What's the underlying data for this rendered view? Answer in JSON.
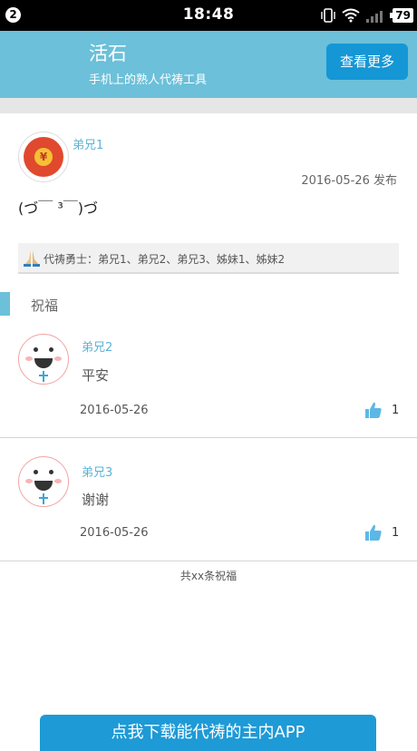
{
  "status_bar": {
    "notification_count": "2",
    "time": "18:48",
    "battery": "79"
  },
  "header": {
    "title": "活石",
    "subtitle": "手机上的熟人代祷工具",
    "more_button": "查看更多"
  },
  "post": {
    "author": "弟兄1",
    "date": "2016-05-26 发布",
    "content": "(づ￣ ³￣)づ",
    "prayer_warriors": "代祷勇士：弟兄1、弟兄2、弟兄3、姊妹1、姊妹2"
  },
  "blessings": {
    "title": "祝福",
    "items": [
      {
        "author": "弟兄2",
        "text": "平安",
        "date": "2016-05-26",
        "likes": "1"
      },
      {
        "author": "弟兄3",
        "text": "谢谢",
        "date": "2016-05-26",
        "likes": "1"
      }
    ],
    "total": "共xx条祝福"
  },
  "footer": {
    "download_button": "点我下载能代祷的主内APP"
  },
  "colors": {
    "header_bg": "#6cc0d9",
    "accent_button": "#1597d6",
    "name_color": "#5bb3d6"
  }
}
